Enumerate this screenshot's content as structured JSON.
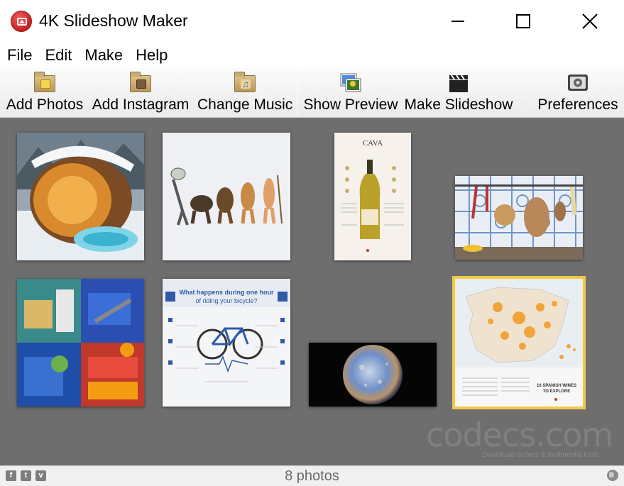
{
  "window": {
    "title": "4K Slideshow Maker"
  },
  "menu": [
    "File",
    "Edit",
    "Make",
    "Help"
  ],
  "toolbar": {
    "add_photos": "Add Photos",
    "add_instagram": "Add Instagram",
    "change_music": "Change Music",
    "show_preview": "Show Preview",
    "make_slideshow": "Make Slideshow",
    "preferences": "Preferences"
  },
  "photos": [
    {
      "subject": "snowy barrel sauna"
    },
    {
      "subject": "evolution illustration"
    },
    {
      "subject": "cava wine infographic",
      "title_text": "CAVA"
    },
    {
      "subject": "kitchen tiles with cutting boards"
    },
    {
      "subject": "colorful workshop collage"
    },
    {
      "subject": "bicycle infographic",
      "title_text": "What happens during one hour of riding your bicycle?"
    },
    {
      "subject": "planet mercury"
    },
    {
      "subject": "map of Spain wines",
      "title_text": "16 SPANISH WINES TO EXPLORE",
      "selected": true
    }
  ],
  "watermark": {
    "text": "codecs.com",
    "sub": "Download codecs & multimedia tools"
  },
  "status": {
    "photo_count": "8 photos",
    "social": [
      "f",
      "t",
      "v"
    ]
  },
  "colors": {
    "workspace_bg": "#6e6e6e",
    "selection": "#f0c94a",
    "app_icon": "#d62828"
  }
}
